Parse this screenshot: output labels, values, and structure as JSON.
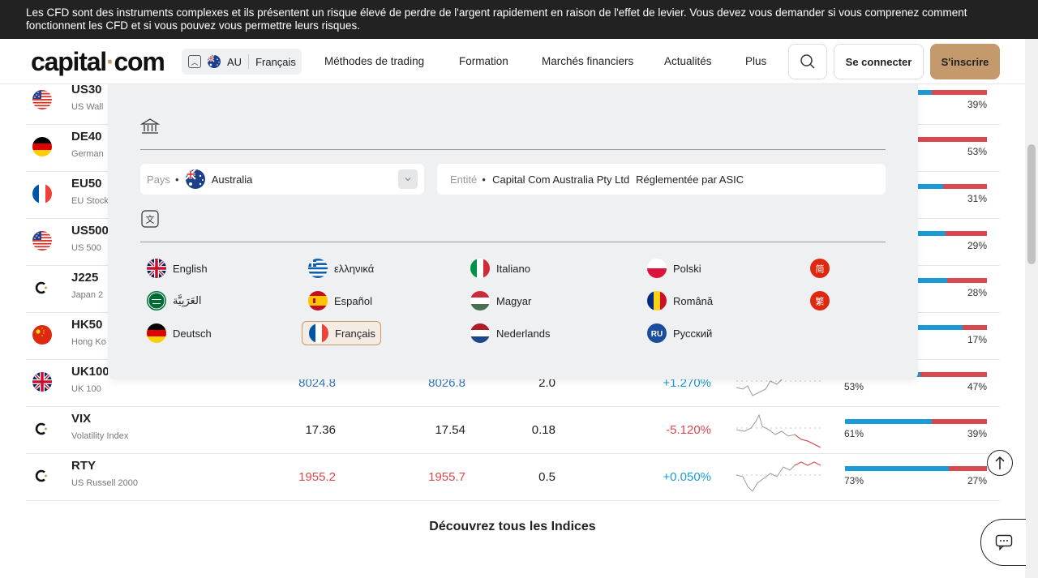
{
  "risk_banner": {
    "text": "Les CFD sont des instruments complexes et ils présentent un risque élevé de perdre de l'argent rapidement en raison de l'effet de levier. Vous devez vous demander si vous comprenez comment fonctionnent les CFD et si vous pouvez vous permettre leurs risques."
  },
  "header": {
    "logo_main": "capital",
    "logo_dot": "·",
    "logo_tld": "com",
    "locale": {
      "code": "AU",
      "language": "Français"
    },
    "nav": [
      "Méthodes de trading",
      "Formation",
      "Marchés financiers",
      "Actualités",
      "Plus"
    ],
    "login_label": "Se connecter",
    "signup_label": "S'inscrire"
  },
  "table": {
    "rows": [
      {
        "symbol": "US30",
        "desc": "US Wall",
        "flag": "us-flag",
        "sell": "",
        "buy": "",
        "spread": "",
        "change": "",
        "buy_pct": 0.61,
        "left_pct": "",
        "right_pct": "39%"
      },
      {
        "symbol": "DE40",
        "desc": "German",
        "flag": "de-flag",
        "sell": "",
        "buy": "",
        "spread": "",
        "change": "",
        "buy_pct": 0.47,
        "left_pct": "",
        "right_pct": "53%"
      },
      {
        "symbol": "EU50",
        "desc": "EU Stock",
        "flag": "fr-flag",
        "sell": "",
        "buy": "",
        "spread": "",
        "change": "",
        "buy_pct": 0.69,
        "left_pct": "",
        "right_pct": "31%"
      },
      {
        "symbol": "US500",
        "desc": "US 500",
        "flag": "us-flag",
        "sell": "",
        "buy": "",
        "spread": "",
        "change": "",
        "buy_pct": 0.71,
        "left_pct": "",
        "right_pct": "29%"
      },
      {
        "symbol": "J225",
        "desc": "Japan 2",
        "flag": "capital-logo",
        "sell": "",
        "buy": "",
        "spread": "",
        "change": "",
        "buy_pct": 0.72,
        "left_pct": "",
        "right_pct": "28%"
      },
      {
        "symbol": "HK50",
        "desc": "Hong Ko",
        "flag": "cn-flag",
        "sell": "",
        "buy": "",
        "spread": "",
        "change": "",
        "buy_pct": 0.83,
        "left_pct": "",
        "right_pct": "17%"
      },
      {
        "symbol": "UK100",
        "desc": "UK 100",
        "flag": "uk-flag",
        "sell": "8024.8",
        "buy": "8026.8",
        "spread": "2.0",
        "change": "+1.270%",
        "color": "blue",
        "buy_pct": 0.53,
        "left_pct": "53%",
        "right_pct": "47%"
      },
      {
        "symbol": "VIX",
        "desc": "Volatility Index",
        "flag": "capital-logo",
        "sell": "17.36",
        "buy": "17.54",
        "spread": "0.18",
        "change": "-5.120%",
        "color": "dark",
        "change_color": "red",
        "buy_pct": 0.61,
        "left_pct": "61%",
        "right_pct": "39%"
      },
      {
        "symbol": "RTY",
        "desc": "US Russell 2000",
        "flag": "capital-logo",
        "sell": "1955.2",
        "buy": "1955.7",
        "spread": "0.5",
        "change": "+0.050%",
        "color": "red",
        "change_color": "blue",
        "buy_pct": 0.73,
        "left_pct": "73%",
        "right_pct": "27%"
      }
    ],
    "discover_label": "Découvrez tous les Indices"
  },
  "dropdown": {
    "country_label": "Pays",
    "country_value": "Australia",
    "entity_label": "Entité",
    "entity_value": "Capital Com Australia Pty Ltd",
    "entity_reg": "Réglementée par ASIC",
    "languages": [
      {
        "name": "English",
        "flag": "uk-flag"
      },
      {
        "name": "ελληνικά",
        "flag": "gr-flag"
      },
      {
        "name": "Italiano",
        "flag": "it-flag"
      },
      {
        "name": "Polski",
        "flag": "pl-flag"
      },
      {
        "name": "简",
        "flag": "zh-simplified-icon"
      },
      {
        "name": "العَرَبِيَّة",
        "flag": "sa-flag"
      },
      {
        "name": "Español",
        "flag": "es-flag"
      },
      {
        "name": "Magyar",
        "flag": "hu-flag"
      },
      {
        "name": "Română",
        "flag": "ro-flag"
      },
      {
        "name": "繁",
        "flag": "zh-traditional-icon"
      },
      {
        "name": "Deutsch",
        "flag": "de-flag"
      },
      {
        "name": "Français",
        "flag": "fr-flag",
        "active": true
      },
      {
        "name": "Nederlands",
        "flag": "nl-flag"
      },
      {
        "name": "Русский",
        "flag": "ru-icon",
        "badge": "RU"
      }
    ]
  },
  "colors": {
    "brand_gold": "#c49a6c",
    "sell_red": "#d9474f",
    "buy_blue": "#1a9bd7"
  }
}
